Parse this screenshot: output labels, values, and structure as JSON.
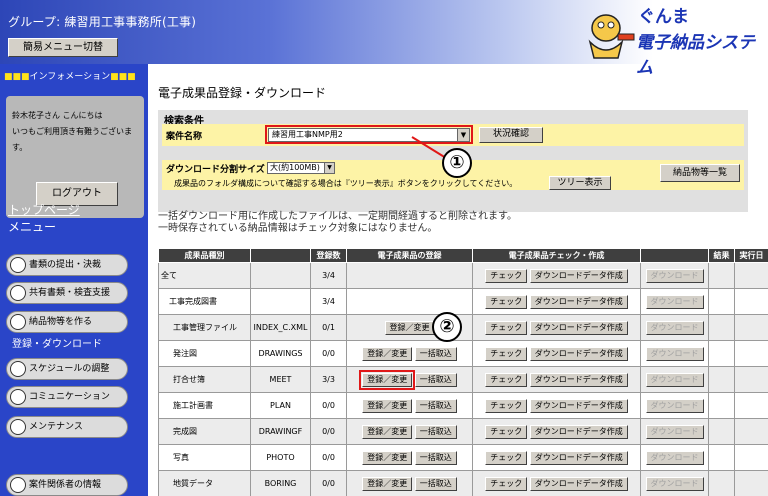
{
  "header": {
    "group_label": "グループ: 練習用工事事務所(工事)",
    "simple_menu_button": "簡易メニュー切替",
    "logo_line1": "ぐんま",
    "logo_line2": "電子納品システム"
  },
  "sidebar": {
    "info_title_marks": "■■■",
    "info_title_text": "インフォメーション",
    "greeting_line1": "鈴木花子さん こんにちは",
    "greeting_line2": "いつもご利用頂き有難うございます。",
    "logout_button": "ログアウト",
    "top_page_link": "トップページ",
    "menu_label": "メニュー",
    "items": [
      {
        "label": "書類の提出・決裁"
      },
      {
        "label": "共有書類・検査支援"
      },
      {
        "label": "納品物等を作る"
      },
      {
        "label": "スケジュールの調整"
      },
      {
        "label": "コミュニケーション"
      },
      {
        "label": "メンテナンス"
      },
      {
        "label": "案件関係者の情報"
      }
    ],
    "active_item": "登録・ダウンロード"
  },
  "main": {
    "page_title": "電子成果品登録・ダウンロード",
    "search": {
      "title": "検索条件",
      "case_label": "案件名称",
      "case_value": "練習用工事NMP用2",
      "status_button": "状況確認",
      "dl_size_label": "ダウンロード分割サイズ",
      "dl_size_value": "大(約100MB)",
      "tree_note": "成果品のフォルダ構成について確認する場合は『ツリー表示』ボタンをクリックしてください。",
      "tree_button": "ツリー表示",
      "deliverables_button": "納品物等一覧"
    },
    "callout1": "①",
    "callout2": "②",
    "notice_line1": "一括ダウンロード用に作成したファイルは、一定期間経過すると削除されます。",
    "notice_line2": "一時保存されている納品情報はチェック対象にはなりません。",
    "table": {
      "headers": [
        "成果品種別",
        "",
        "登録数",
        "電子成果品の登録",
        "電子成果品チェック・作成",
        "",
        "結果",
        "実行日"
      ],
      "register_label": "登録／変更",
      "bulk_label": "一括取込",
      "check_label": "チェック",
      "dl_create_label": "ダウンロードデータ作成",
      "dl_label": "ダウンロード",
      "rows": [
        {
          "type": "全て",
          "code": "",
          "count": "3/4"
        },
        {
          "type": "工事完成図書",
          "code": "",
          "count": "3/4"
        },
        {
          "type": "工事管理ファイル",
          "code": "INDEX_C.XML",
          "count": "0/1"
        },
        {
          "type": "発注図",
          "code": "DRAWINGS",
          "count": "0/0"
        },
        {
          "type": "打合せ簿",
          "code": "MEET",
          "count": "3/3"
        },
        {
          "type": "施工計画書",
          "code": "PLAN",
          "count": "0/0"
        },
        {
          "type": "完成図",
          "code": "DRAWINGF",
          "count": "0/0"
        },
        {
          "type": "写真",
          "code": "PHOTO",
          "count": "0/0"
        },
        {
          "type": "地質データ",
          "code": "BORING",
          "count": "0/0"
        }
      ]
    }
  }
}
